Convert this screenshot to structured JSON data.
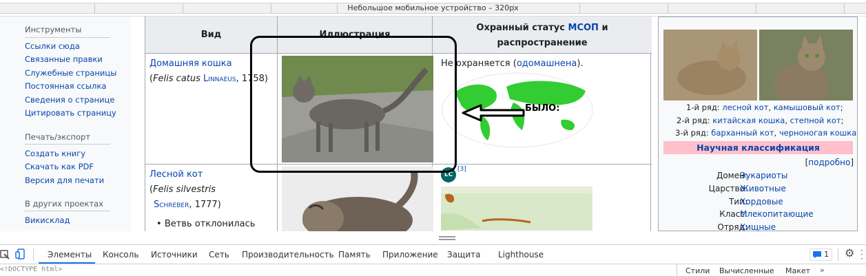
{
  "device_bar": {
    "label": "Небольшое мобильное устройство – 320px"
  },
  "sidebar": {
    "tools_heading": "Инструменты",
    "tools": [
      "Ссылки сюда",
      "Связанные правки",
      "Служебные страницы",
      "Постоянная ссылка",
      "Сведения о странице",
      "Цитировать страницу"
    ],
    "print_heading": "Печать/экспорт",
    "print": [
      "Создать книгу",
      "Скачать как PDF",
      "Версия для печати"
    ],
    "projects_heading": "В других проектах",
    "projects": [
      "Викисклад"
    ]
  },
  "table": {
    "headers": {
      "species": "Вид",
      "illustration": "Иллюстрация",
      "status_prefix": "Охранный статус",
      "status_link": "МСОП",
      "status_suffix": "и",
      "status_line2": "распространение"
    },
    "rows": [
      {
        "name": "Домашняя кошка",
        "open": "(",
        "latin": "Felis catus",
        "author": "Linnaeus",
        "year_part1": ", 1",
        "year_part2": "758)",
        "status_pre": "Не охраняется (",
        "status_link": "одомашнена",
        "status_post": ")."
      },
      {
        "name": "Лесной кот",
        "open": "(",
        "latin": "Felis silvestris",
        "author": "Schreber",
        "year": ", 1777)",
        "bullet": "Ветвь отклонилась",
        "badge": "LC",
        "ref": "[3]"
      }
    ]
  },
  "annotation": {
    "text": "БЫЛО:"
  },
  "infobox": {
    "captions": [
      {
        "prefix": "1-й ряд: ",
        "links": [
          "лесной кот",
          "камышовый кот"
        ],
        "suffix": ";"
      },
      {
        "prefix": "2-й ряд: ",
        "links": [
          "китайская кошка",
          "степной кот"
        ],
        "suffix": ";"
      },
      {
        "prefix": "3-й ряд: ",
        "links": [
          "барханный кот",
          "черноногая кошка"
        ],
        "suffix": ""
      }
    ],
    "classification_header": "Научная классификация",
    "details": {
      "open": "[",
      "link": "подробно",
      "close": "]"
    },
    "ranks": [
      {
        "label": "Домен:",
        "value": "Эукариоты"
      },
      {
        "label": "Царство:",
        "value": "Животные"
      },
      {
        "label": "Тип:",
        "value": "Хордовые"
      },
      {
        "label": "Класс:",
        "value": "Млекопитающие"
      },
      {
        "label": "Отряд:",
        "value": "Хищные"
      }
    ]
  },
  "devtools": {
    "tabs": [
      "Элементы",
      "Консоль",
      "Источники",
      "Сеть",
      "Производительность",
      "Память",
      "Приложение",
      "Защита",
      "Lighthouse"
    ],
    "active_tab": "Элементы",
    "issues_count": "1",
    "code_line": "<!DOCTYPE html>",
    "styles_tabs": [
      "Стили",
      "Вычисленные",
      "Макет"
    ]
  },
  "colors": {
    "link": "#0645ad",
    "accent": "#1a73e8",
    "infobox_header": "#ffc0cb",
    "badge": "#006666"
  },
  "icons": [
    "inspect-icon",
    "device-toggle-icon",
    "issues-icon",
    "settings-icon",
    "more-icon"
  ]
}
